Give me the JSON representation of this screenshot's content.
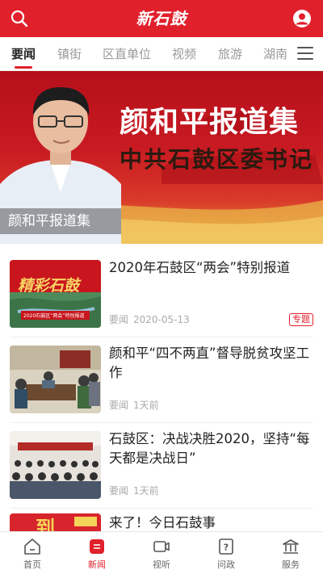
{
  "header": {
    "logo_text": "新石鼓",
    "brand_color": "#e0202b",
    "search_icon": "search-icon",
    "user_icon": "user-icon"
  },
  "tabs": [
    {
      "label": "要闻",
      "active": true
    },
    {
      "label": "镇街",
      "active": false
    },
    {
      "label": "区直单位",
      "active": false
    },
    {
      "label": "视频",
      "active": false
    },
    {
      "label": "旅游",
      "active": false
    },
    {
      "label": "湖南",
      "active": false
    }
  ],
  "banner": {
    "headline": "颜和平报道集",
    "subheadline": "中共石鼓区委书记",
    "caption": "颜和平报道集",
    "slide_count": 3,
    "active_slide": 2
  },
  "news": [
    {
      "title": "2020年石鼓区“两会”特别报道",
      "channel": "要闻",
      "time": "2020-05-13",
      "tag": "专题",
      "thumb_text": "精彩石鼓",
      "thumb_sub": "2020石鼓区“两会”特别报道"
    },
    {
      "title": "颜和平“四不两直”督导脱贫攻坚工作",
      "channel": "要闻",
      "time": "1天前",
      "tag": ""
    },
    {
      "title": "石鼓区：决战决胜2020，坚持“每天都是决战日”",
      "channel": "要闻",
      "time": "1天前",
      "tag": ""
    },
    {
      "title": "来了！今日石鼓事",
      "channel": "",
      "time": "",
      "tag": "",
      "thumb_text": "到"
    }
  ],
  "bottom_nav": [
    {
      "label": "首页",
      "icon": "home-icon",
      "active": false
    },
    {
      "label": "新闻",
      "icon": "news-icon",
      "active": true
    },
    {
      "label": "视听",
      "icon": "video-icon",
      "active": false
    },
    {
      "label": "问政",
      "icon": "question-icon",
      "active": false
    },
    {
      "label": "服务",
      "icon": "service-icon",
      "active": false
    }
  ]
}
